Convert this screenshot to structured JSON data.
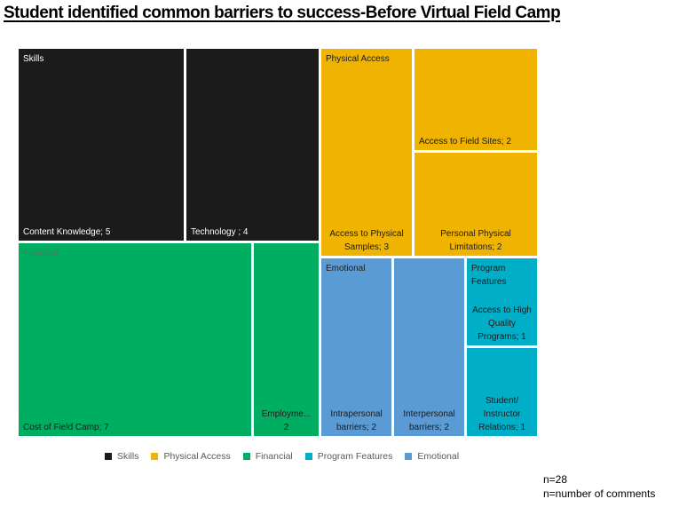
{
  "chart_data": {
    "type": "treemap",
    "title": "Student identified common barriers to success-Before Virtual Field Camp",
    "categories": [
      {
        "name": "Skills",
        "color": "#1b1b1b",
        "label_color": "#ffffff",
        "header_color": "#ffffff",
        "items": [
          {
            "label": "Content Knowledge; 5",
            "name": "Content Knowledge",
            "value": 5
          },
          {
            "label": "Technology ; 4",
            "name": "Technology",
            "value": 4
          }
        ]
      },
      {
        "name": "Physical Access",
        "color": "#f0b400",
        "label_color": "#1b1b1b",
        "header_color": "#1b1b1b",
        "items": [
          {
            "label": "Access to Physical Samples; 3",
            "name": "Access to Physical Samples",
            "value": 3
          },
          {
            "label": "Access to Field Sites; 2",
            "name": "Access to Field Sites",
            "value": 2
          },
          {
            "label": "Personal Physical Limitations; 2",
            "name": "Personal Physical Limitations",
            "value": 2
          }
        ]
      },
      {
        "name": "Financial",
        "color": "#00ae62",
        "label_color": "#1b1b1b",
        "header_color": "#4a7a5e",
        "items": [
          {
            "label": "Cost of Field Camp; 7",
            "name": "Cost of Field Camp",
            "value": 7
          },
          {
            "label": "Employme... 2",
            "name": "Employment",
            "value": 2
          }
        ]
      },
      {
        "name": "Emotional",
        "color": "#5b9bd5",
        "label_color": "#1b1b1b",
        "header_color": "#1b1b1b",
        "items": [
          {
            "label": "Intrapersonal barriers; 2",
            "name": "Intrapersonal barriers",
            "value": 2
          },
          {
            "label": "Interpersonal barriers; 2",
            "name": "Interpersonal barriers",
            "value": 2
          }
        ]
      },
      {
        "name": "Program Features",
        "color": "#00aec8",
        "label_color": "#1b1b1b",
        "header_color": "#1b1b1b",
        "items": [
          {
            "label": "Access to High Quality Programs; 1",
            "name": "Access to High Quality Programs",
            "value": 1
          },
          {
            "label": "Student/ Instructor Relations; 1",
            "name": "Student/Instructor Relations",
            "value": 1
          }
        ]
      }
    ],
    "legend": {
      "placement": "bottom",
      "entries": [
        {
          "label": "Skills",
          "color": "#1b1b1b"
        },
        {
          "label": "Physical Access",
          "color": "#f0b400"
        },
        {
          "label": "Financial",
          "color": "#00ae62"
        },
        {
          "label": "Program Features",
          "color": "#00aec8"
        },
        {
          "label": "Emotional",
          "color": "#5b9bd5"
        }
      ]
    }
  },
  "notes": {
    "n": "n=28",
    "definition": "n=number of comments"
  }
}
